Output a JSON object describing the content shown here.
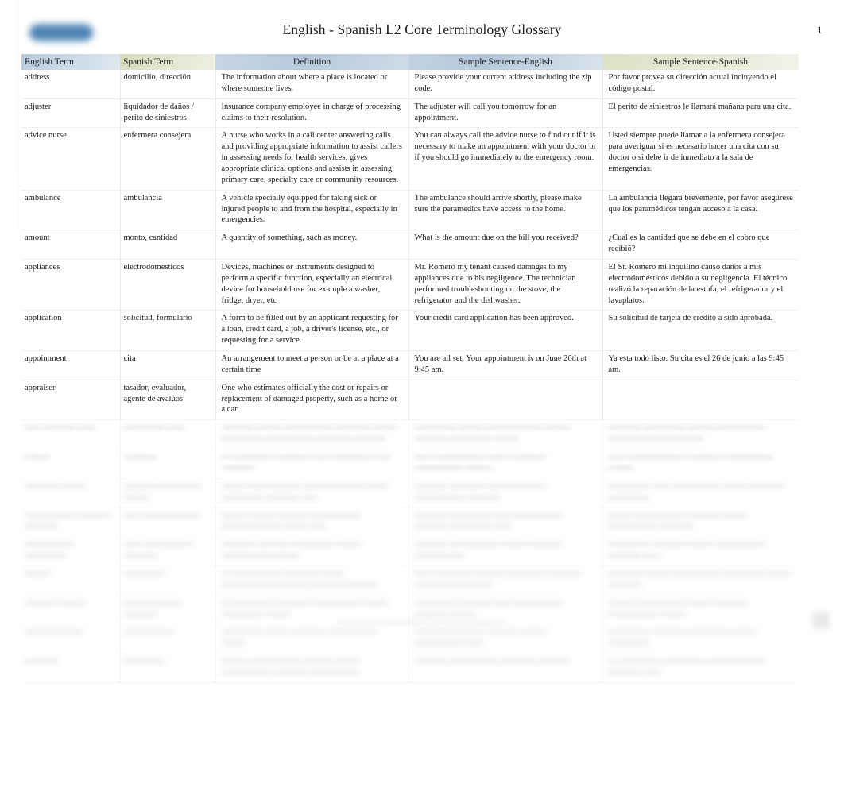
{
  "document": {
    "title": "English - Spanish  L2 Core Terminology Glossary",
    "page_number": "1",
    "logo": "brand-logo-redacted",
    "footer_text": "",
    "footer_state": "blurred"
  },
  "table": {
    "headers": [
      "English Term",
      "Spanish Term",
      "Definition",
      "Sample Sentence-English",
      "Sample Sentence-Spanish"
    ],
    "header_colors": {
      "english_term": "#c9d8e5",
      "spanish_term": "#e2e6cf",
      "definition": "#b6c9db",
      "sample_english": "#b5c8da",
      "sample_spanish": "#e5e9d6"
    },
    "rows": [
      {
        "english": "address",
        "spanish": "domicilio, dirección",
        "definition": "The information about where a place is located or where someone lives.",
        "sample_en": "Please provide your current address including the zip code.",
        "sample_es": "Por favor provea su dirección actual incluyendo el código postal."
      },
      {
        "english": "adjuster",
        "spanish": "liquidador de daños / perito de siniestros",
        "definition": "Insurance company employee in charge of processing claims to their resolution.",
        "sample_en": "The adjuster will call you tomorrow for an appointment.",
        "sample_es": "El perito de siniestros le llamará mañana para una cita."
      },
      {
        "english": "advice nurse",
        "spanish": "enfermera consejera",
        "definition": "A nurse who works in a call center answering calls and providing appropriate information to assist callers in assessing needs for health services; gives appropriate clinical options and assists in assessing primary care, specialty care or community resources.",
        "sample_en": "You can always call the advice nurse to find out if it is necessary to make an appointment with your doctor or if you should go immediately to the emergency room.",
        "sample_es": "Usted siempre puede llamar a la enfermera consejera para averiguar si es necesario hacer una cita con su doctor o si debe ir de inmediato a la sala de emergencias."
      },
      {
        "english": "ambulance",
        "spanish": "ambulancia",
        "definition": "A vehicle specially equipped for taking sick or injured people to and from the hospital, especially in emergencies.",
        "sample_en": "The ambulance should arrive shortly, please make sure the paramedics have access to the home.",
        "sample_es": "La ambulancia llegará brevemente, por favor asegúrese que los paramédicos tengan acceso a la casa."
      },
      {
        "english": "amount",
        "spanish": "monto, cantidad",
        "definition": "A quantity of something, such as money.",
        "sample_en": "What is the amount due on the bill you received?",
        "sample_es": "¿Cual es la cantidad que se debe en el cobro que recibió?"
      },
      {
        "english": "appliances",
        "spanish": "electrodomésticos",
        "definition": "Devices, machines or instruments designed to perform a specific function, especially an electrical device for household use for example a washer, fridge, dryer, etc",
        "sample_en": "Mr. Romero my tenant caused damages to my appliances due to his negligence. The technician performed troubleshooting on the stove, the refrigerator and the dishwasher.",
        "sample_es": "El Sr. Romero mi inquilino causó daños a mis electrodomésticos debido a su negligencia. El técnico realizó la reparación de la estufa, el refrigerador y el lavaplatos."
      },
      {
        "english": "application",
        "spanish": "solicitud, formulario",
        "definition": "A form to be filled out by an applicant requesting for a loan, credit card, a job, a driver's license, etc., or requesting for a service.",
        "sample_en": "Your credit card application has been approved.",
        "sample_es": "Su solicitud de tarjeta de crédito a sido aprobada."
      },
      {
        "english": "appointment",
        "spanish": "cita",
        "definition": "An arrangement to meet a person or be at a place at a certain time",
        "sample_en": "You are all set.     Your appointment is on June 26th at 9:45 am.",
        "sample_es": "Ya esta todo listo. Su cita es el 26 de junio a las 9:45 am."
      },
      {
        "english": "appraiser",
        "spanish": "tasador, evaluador, agente de avalúos",
        "definition": "One who estimates officially the cost or repairs or replacement of damaged property, such as a home or a car.",
        "sample_en": "",
        "sample_es": ""
      }
    ],
    "blurred_rows": [
      {
        "english": "—— ———— ——",
        "spanish": "————— ——",
        "definition": "———— ——— —————— ———— ——— ————— —————— ———— ————",
        "sample_en": "————— ——— ——————— ——— ———— ————— ———",
        "sample_es": "———— ————— ——— —————— ———— ————— ——"
      },
      {
        "english": "———",
        "spanish": "————",
        "definition": "— ————— ———— —— ————— —— ————",
        "sample_en": "—— —————— ——— ———— —————— ———",
        "sample_es": "—— ——————— ———— —————— ———"
      },
      {
        "english": "———— ———",
        "spanish": "———— ————— ———",
        "definition": "——— —— ———— ——————— ——— ————— ———— ——",
        "sample_en": "———— ———— —— ————— —————— ————",
        "sample_es": "————— —— —————— ——— ———— —————"
      },
      {
        "english": "—————— ———— ————",
        "spanish": "—— ———————",
        "definition": "——— ——— ———— —————— ——————— ——— ——",
        "sample_en": "———— ————— —— —————— ———— ————— ——",
        "sample_es": "——— —————— ———— ——— —————— ————"
      },
      {
        "english": "—————— —————",
        "spanish": "—— —————— ————",
        "definition": "———— ———— ————— ——— —————— ———",
        "sample_en": "———— —————— ——— ———— ——————",
        "sample_es": "————— ———— ——— —————— ———— ——"
      },
      {
        "english": "———",
        "spanish": "—————",
        "definition": "— —————— ———— ——— ——————— ——— ———— ————",
        "sample_en": "—— ————— ——— ————— ———— —————— ———",
        "sample_es": "———— ——— —————— ————— ——— ————"
      },
      {
        "english": "———— ———",
        "spanish": "——————— ————",
        "definition": "— ————— ———— —————— ——— ————— ———",
        "sample_en": "————— ———— —— —————— ———— ———",
        "sample_es": "——— —————— ——— ———— —————— ———"
      },
      {
        "english": "———————",
        "spanish": "——————",
        "definition": "————— ——— ———— —————— ———",
        "sample_en": "—— —————— ———— ——— —————— ——",
        "sample_es": "————— ———— ————— ——— —————"
      },
      {
        "english": "————",
        "spanish": "—————",
        "definition": "——— —————— ———— ——— —————— ———— ——————",
        "sample_en": "———— —————— ———— ————",
        "sample_es": "— ————— ————— ——————— ———— ——"
      }
    ]
  }
}
